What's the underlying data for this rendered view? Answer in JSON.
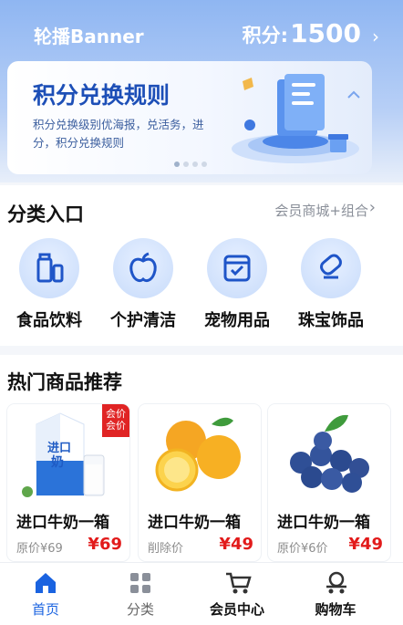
{
  "header": {
    "brand": "轮播Banner",
    "points_label": "积分:",
    "points_value": "1500"
  },
  "banner": {
    "title": "积分兑换规则",
    "description": "积分兑换级别优海报，兑活务，进分，积分兑换规则",
    "page_count": 4,
    "active_page": 1
  },
  "categories_section": {
    "title": "分类入口",
    "link": "会员商城+组合",
    "items": [
      {
        "label": "食品饮料",
        "icon": "drink-bottles-icon"
      },
      {
        "label": "个护清洁",
        "icon": "apple-icon"
      },
      {
        "label": "宠物用品",
        "icon": "calendar-check-icon"
      },
      {
        "label": "珠宝饰品",
        "icon": "jewelry-tag-icon"
      }
    ]
  },
  "hot_section": {
    "title": "热门商品推荐",
    "products": [
      {
        "name": "进口牛奶一箱",
        "orig": "原价¥69",
        "price": "¥69",
        "tag": "会价会价",
        "image": "milk-carton"
      },
      {
        "name": "进口牛奶一箱",
        "orig": "削除价",
        "price": "¥49",
        "image": "oranges"
      },
      {
        "name": "进口牛奶一箱",
        "orig": "原价¥6价",
        "price": "¥49",
        "image": "blueberries"
      }
    ]
  },
  "tabbar": {
    "items": [
      {
        "label": "首页",
        "icon": "home-icon",
        "active": true
      },
      {
        "label": "分类",
        "icon": "grid-icon",
        "active": false
      },
      {
        "label": "会员中心",
        "icon": "cart-icon",
        "active": false
      },
      {
        "label": "购物车",
        "icon": "shopping-trolley-icon",
        "active": false
      }
    ]
  },
  "colors": {
    "accent": "#1a63e0",
    "price": "#e21b1b",
    "banner_title": "#1d4fb7"
  }
}
